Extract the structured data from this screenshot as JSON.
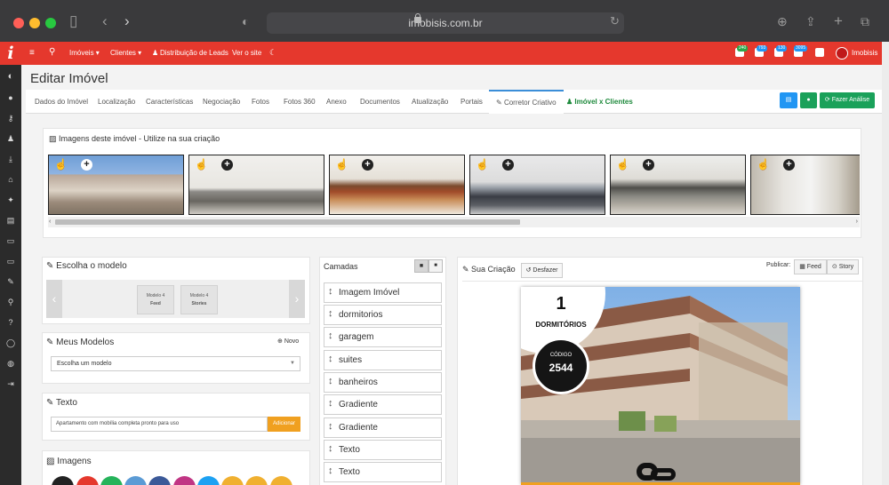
{
  "browser": {
    "url": "imobisis.com.br"
  },
  "navbar": {
    "menu_icon": "hamburger-icon",
    "search_icon": "search-icon",
    "items": [
      "Imóveis ▾",
      "Clientes ▾",
      "Distribuição de Leads",
      "Ver o site"
    ],
    "badges": [
      "240",
      "793",
      "130",
      "3095"
    ],
    "brand": "Imobisis"
  },
  "page": {
    "title": "Editar Imóvel"
  },
  "tabs": {
    "items": [
      "Dados do Imóvel",
      "Localização",
      "Características",
      "Negociação",
      "Fotos",
      "Fotos 360",
      "Anexo",
      "Documentos",
      "Atualização",
      "Portais"
    ],
    "active": "Corretor Criativo",
    "extra": "Imóvel x Clientes"
  },
  "actions": {
    "analyze": "Fazer Análise"
  },
  "images_panel": {
    "title": "Imagens deste imóvel - Utilize na sua criação"
  },
  "model_panel": {
    "title": "Escolha o modelo",
    "cards": [
      {
        "name": "Modelo 4",
        "type": "Feed"
      },
      {
        "name": "Modelo 4",
        "type": "Stories"
      }
    ]
  },
  "my_models": {
    "title": "Meus Modelos",
    "new_label": "Novo",
    "select_value": "Escolha um modelo"
  },
  "text_panel": {
    "title": "Texto",
    "input_value": "Apartamento com mobília completa pronto para uso",
    "add_label": "Adicionar"
  },
  "images_section": {
    "title": "Imagens"
  },
  "layers": {
    "title": "Camadas",
    "items": [
      "Imagem Imóvel",
      "dormitorios",
      "garagem",
      "suites",
      "banheiros",
      "Gradiente",
      "Gradiente",
      "Texto",
      "Texto"
    ]
  },
  "creation": {
    "title": "Sua Criação",
    "undo_label": "Desfazer",
    "publish_label": "Publicar:",
    "feed_label": "Feed",
    "story_label": "Story",
    "bedrooms_count": "1",
    "bedrooms_label": "DORMITÓRIOS",
    "code_label": "CÓDIGO",
    "code_value": "2544"
  },
  "colors": {
    "brand_red": "#e5382d",
    "green": "#1e8a3c",
    "teal": "#1aa15a",
    "blue": "#2196f3",
    "orange": "#f0a020"
  }
}
